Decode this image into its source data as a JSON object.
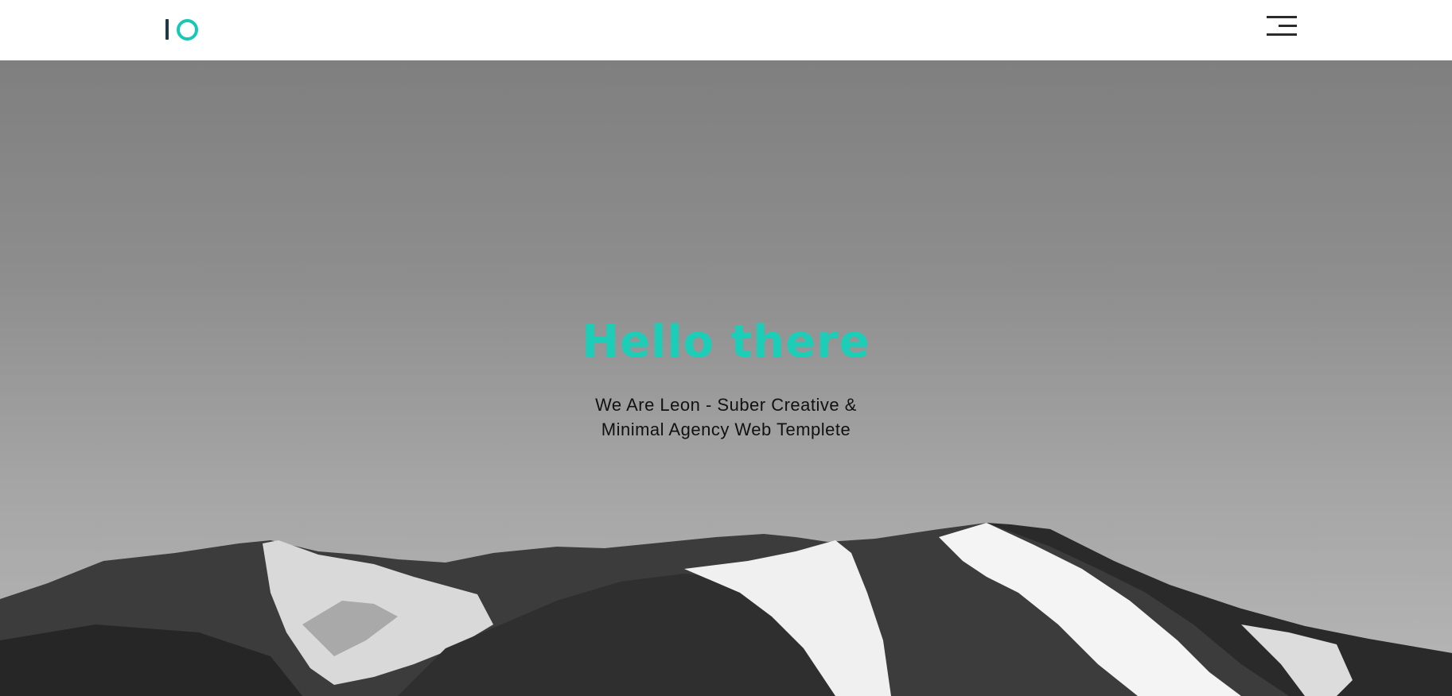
{
  "header": {
    "logo_icon": "io-logo-icon",
    "menu_icon": "hamburger-menu-icon",
    "colors": {
      "logo_bar": "#1f3a44",
      "logo_ring": "#18c7b5",
      "menu_lines": "#2b2b2b"
    }
  },
  "hero": {
    "title": "Hello there",
    "subtitle_line1": "We Are Leon - Suber Creative &",
    "subtitle_line2": "Minimal Agency Web Templete",
    "background": "grayscale-mountain-photo",
    "colors": {
      "title": "#1ccdb8",
      "subtitle": "#111111"
    }
  }
}
